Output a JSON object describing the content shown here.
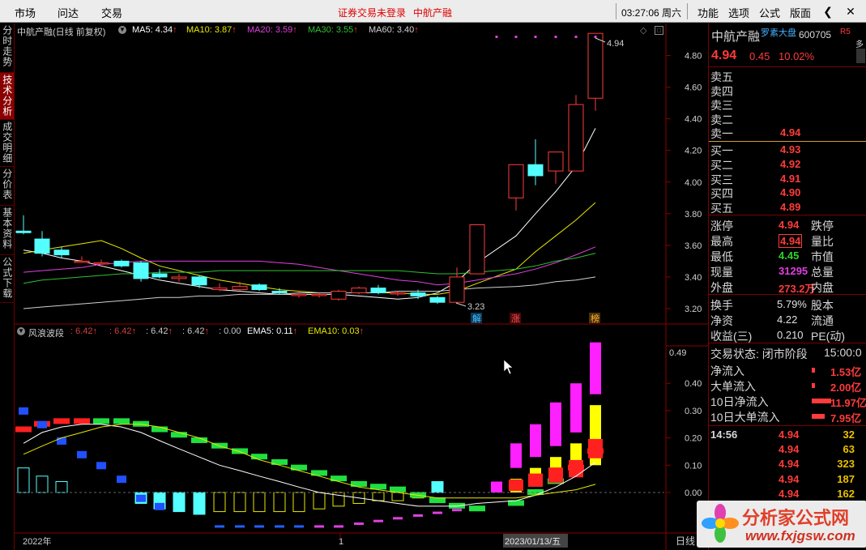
{
  "topbar": {
    "menu": [
      "市场",
      "问达",
      "交易"
    ],
    "notice": "证券交易未登录",
    "stock_name": "中航产融",
    "time": "03:27:06 周六",
    "right_menu": [
      "功能",
      "选项",
      "公式",
      "版面"
    ]
  },
  "left_tabs": [
    "分时走势",
    "技术分析",
    "成交明细",
    "分价表",
    "基本资料",
    "公式下载"
  ],
  "main_chart": {
    "title": "中航产融(日线 前复权)",
    "ma": [
      {
        "label": "MA5: 4.34",
        "color": "#ffffff"
      },
      {
        "label": "MA10: 3.87",
        "color": "#e8e800"
      },
      {
        "label": "MA20: 3.59",
        "color": "#e040e0"
      },
      {
        "label": "MA30: 3.55",
        "color": "#30c030"
      },
      {
        "label": "MA60: 3.40",
        "color": "#d0d0d0"
      }
    ],
    "y_ticks": [
      "4.80",
      "4.60",
      "4.40",
      "4.20",
      "4.00",
      "3.80",
      "3.60",
      "3.40",
      "3.20"
    ],
    "high_label": "4.94",
    "low_label": "3.23",
    "markers": [
      "解",
      "涨",
      "榜"
    ]
  },
  "indicator": {
    "name": "风浪波段",
    "values": [
      ": 6.42",
      ": 6.42",
      ": 6.42",
      ": 6.42",
      ": 0.00"
    ],
    "ema5": "EMA5: 0.11",
    "ema10": "EMA10: 0.03",
    "y_ticks": [
      "0.40",
      "0.30",
      "0.20",
      "0.10",
      "0.00"
    ],
    "current": "0.49"
  },
  "xaxis": {
    "start": "2022年",
    "mid": "1",
    "cursor": "2023/01/13/五",
    "mode": "日线"
  },
  "quote": {
    "name": "中航产融",
    "tag": "罗素大盘",
    "code": "600705",
    "badge": "R5",
    "price": "4.94",
    "change": "0.45",
    "pct": "10.02%",
    "sell": [
      {
        "label": "卖五",
        "price": ""
      },
      {
        "label": "卖四",
        "price": ""
      },
      {
        "label": "卖三",
        "price": ""
      },
      {
        "label": "卖二",
        "price": ""
      },
      {
        "label": "卖一",
        "price": "4.94"
      }
    ],
    "buy": [
      {
        "label": "买一",
        "price": "4.93"
      },
      {
        "label": "买二",
        "price": "4.92"
      },
      {
        "label": "买三",
        "price": "4.91"
      },
      {
        "label": "买四",
        "price": "4.90"
      },
      {
        "label": "买五",
        "price": "4.89"
      }
    ],
    "stats": [
      {
        "l": "涨停",
        "v": "4.94",
        "r": "跌停",
        "c": "#ff3b3b"
      },
      {
        "l": "最高",
        "v": "4.94",
        "r": "量比",
        "c": "#ff3b3b"
      },
      {
        "l": "最低",
        "v": "4.45",
        "r": "市值",
        "c": "#30d030"
      },
      {
        "l": "现量",
        "v": "31295",
        "r": "总量",
        "c": "#e040e0"
      },
      {
        "l": "外盘",
        "v": "273.2万",
        "r": "内盘",
        "c": "#ff3b3b"
      }
    ],
    "fin": [
      {
        "l": "换手",
        "v": "5.79%",
        "r": "股本"
      },
      {
        "l": "净资",
        "v": "4.22",
        "r": "流通"
      },
      {
        "l": "收益(三)",
        "v": "0.210",
        "r": "PE(动)"
      }
    ],
    "status_label": "交易状态: 闭市阶段",
    "status_time": "15:00:0",
    "flows": [
      {
        "l": "净流入",
        "v": "1.53亿"
      },
      {
        "l": "大单流入",
        "v": "2.00亿"
      },
      {
        "l": "10日净流入",
        "v": "11.97亿"
      },
      {
        "l": "10日大单流入",
        "v": "7.95亿"
      }
    ],
    "ticks": [
      {
        "t": "14:56",
        "p": "4.94",
        "v": "32"
      },
      {
        "t": "",
        "p": "4.94",
        "v": "63"
      },
      {
        "t": "",
        "p": "4.94",
        "v": "323"
      },
      {
        "t": "",
        "p": "4.94",
        "v": "187"
      },
      {
        "t": "",
        "p": "4.94",
        "v": "162"
      }
    ]
  },
  "watermark": {
    "cn": "分析家公式网",
    "url": "www.fxjgsw.com"
  }
}
